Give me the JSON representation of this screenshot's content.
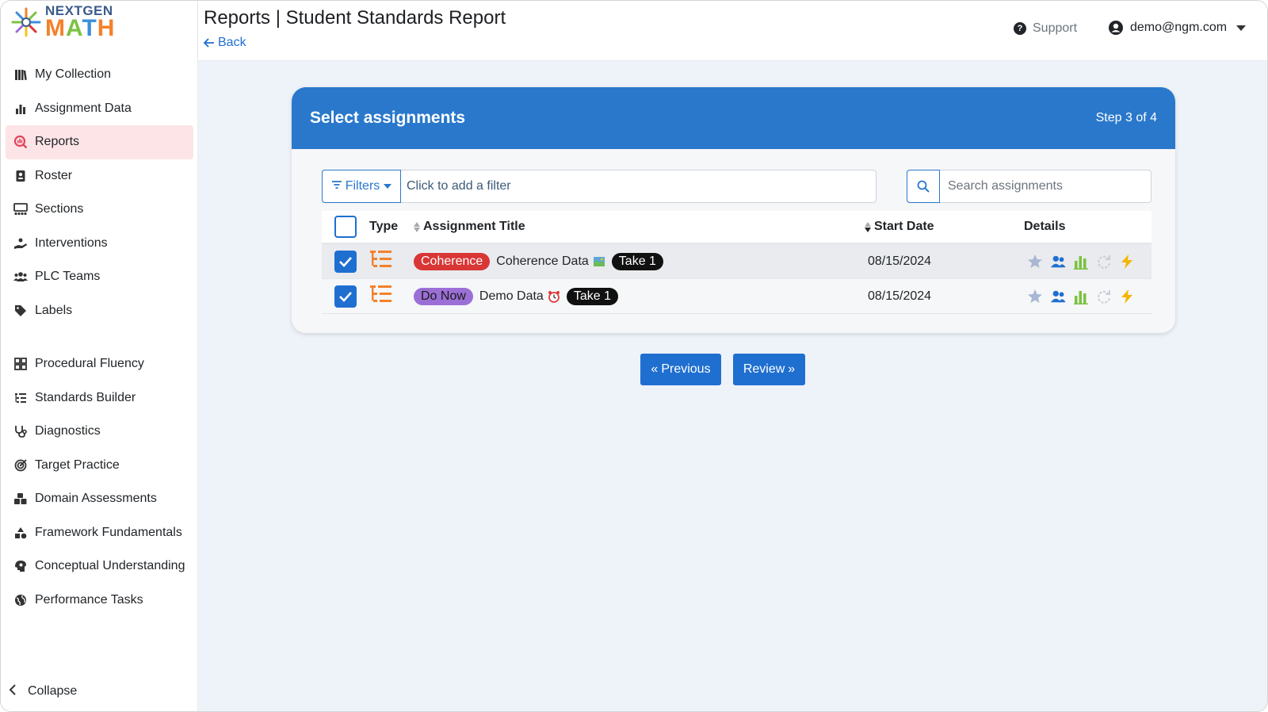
{
  "brand": {
    "line1": "NEXTGEN",
    "line2": "MATH",
    "letters": [
      "M",
      "A",
      "T",
      "H"
    ],
    "letter_colors": [
      "#f4812a",
      "#7cc242",
      "#3a8fd9",
      "#f4812a"
    ]
  },
  "sidebar": {
    "items": [
      {
        "label": "My Collection",
        "icon": "books-icon"
      },
      {
        "label": "Assignment Data",
        "icon": "bar-chart-icon"
      },
      {
        "label": "Reports",
        "icon": "report-search-icon"
      },
      {
        "label": "Roster",
        "icon": "id-badge-icon"
      },
      {
        "label": "Sections",
        "icon": "sections-icon"
      },
      {
        "label": "Interventions",
        "icon": "hand-icon"
      },
      {
        "label": "PLC Teams",
        "icon": "users-icon"
      },
      {
        "label": "Labels",
        "icon": "tag-icon"
      }
    ],
    "items2": [
      {
        "label": "Procedural Fluency",
        "icon": "grid-icon"
      },
      {
        "label": "Standards Builder",
        "icon": "list-tree-icon"
      },
      {
        "label": "Diagnostics",
        "icon": "stethoscope-icon"
      },
      {
        "label": "Target Practice",
        "icon": "target-icon"
      },
      {
        "label": "Domain Assessments",
        "icon": "cubes-icon"
      },
      {
        "label": "Framework Fundamentals",
        "icon": "shapes-icon"
      },
      {
        "label": "Conceptual Understanding",
        "icon": "head-gear-icon"
      },
      {
        "label": "Performance Tasks",
        "icon": "globe-icon"
      }
    ],
    "collapse_label": "Collapse"
  },
  "header": {
    "title": "Reports | Student Standards Report",
    "back_label": "Back",
    "support_label": "Support",
    "user_email": "demo@ngm.com"
  },
  "card": {
    "title": "Select assignments",
    "step": "Step 3 of 4",
    "filters_label": "Filters",
    "filter_placeholder": "Click to add a filter",
    "search_placeholder": "Search assignments"
  },
  "table": {
    "headers": {
      "type": "Type",
      "title": "Assignment Title",
      "start_date": "Start Date",
      "details": "Details"
    },
    "rows": [
      {
        "checked": true,
        "tag": "Coherence",
        "tag_color": "#d93636",
        "title": "Coherence Data",
        "emoji": "map-icon",
        "take": "Take 1",
        "start_date": "08/15/2024"
      },
      {
        "checked": true,
        "tag": "Do Now",
        "tag_color": "#9b6fd6",
        "title": "Demo Data",
        "emoji": "alarm-clock-icon",
        "take": "Take 1",
        "start_date": "08/15/2024"
      }
    ]
  },
  "buttons": {
    "previous": "Previous",
    "review": "Review"
  },
  "colors": {
    "primary": "#2a78cc",
    "active_nav": "#fde4e7",
    "main_bg": "#eef2f9"
  }
}
